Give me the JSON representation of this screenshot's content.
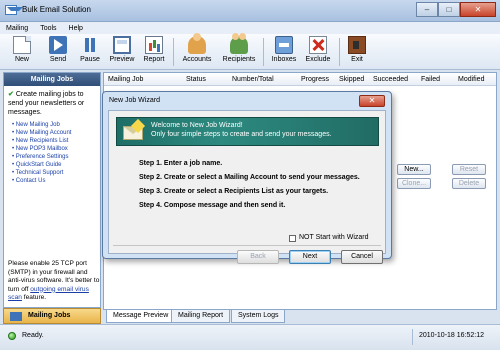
{
  "window": {
    "title": "Bulk Email Solution",
    "minimize": "–",
    "maximize": "□",
    "close": "✕"
  },
  "menu": [
    "Mailing",
    "Tools",
    "Help"
  ],
  "toolbar": {
    "new": "New",
    "send": "Send",
    "pause": "Pause",
    "preview": "Preview",
    "report": "Report",
    "accounts": "Accounts",
    "recipients": "Recipients",
    "inboxes": "Inboxes",
    "exclude": "Exclude",
    "exit": "Exit"
  },
  "left": {
    "header": "Mailing Jobs",
    "intro": "Create mailing jobs to send your newsletters or messages.",
    "links": [
      "New Mailing Job",
      "New Mailing Account",
      "New Recipients List",
      "New POP3 Mailbox",
      "Preference Settings",
      "QuickStart Guide",
      "Technical Support",
      "Contact Us"
    ],
    "note": "Please enable 25 TCP port (SMTP) in your firewall and anti-virus software. It's better to turn off",
    "note_link": "outgoing email virus scan",
    "note_end": "feature.",
    "tab": "Mailing Jobs"
  },
  "grid": {
    "columns": [
      "Mailing Job",
      "Status",
      "Number/Total",
      "Progress",
      "Skipped",
      "Succeeded",
      "Failed",
      "Modified"
    ]
  },
  "side_buttons": {
    "new": "New...",
    "reset": "Reset",
    "clone": "Clone...",
    "delete": "Delete"
  },
  "bottom_tabs": [
    "Message Preview",
    "Mailing Report",
    "System Logs"
  ],
  "status": {
    "ready": "Ready.",
    "timestamp": "2010-10-18 16:52:12"
  },
  "dialog": {
    "title": "New Job Wizard",
    "close": "✕",
    "banner_line1": "Welcome to New Job Wizard!",
    "banner_line2": "Only four simple steps to create and send your messages.",
    "steps": [
      "Step 1. Enter a job name.",
      "Step 2. Create or select a Mailing Account to send your messages.",
      "Step 3. Create or select a Recipients List as your targets.",
      "Step 4. Compose message and then send it."
    ],
    "checkbox_label": "NOT Start with Wizard",
    "back": "Back",
    "next": "Next",
    "cancel": "Cancel"
  }
}
